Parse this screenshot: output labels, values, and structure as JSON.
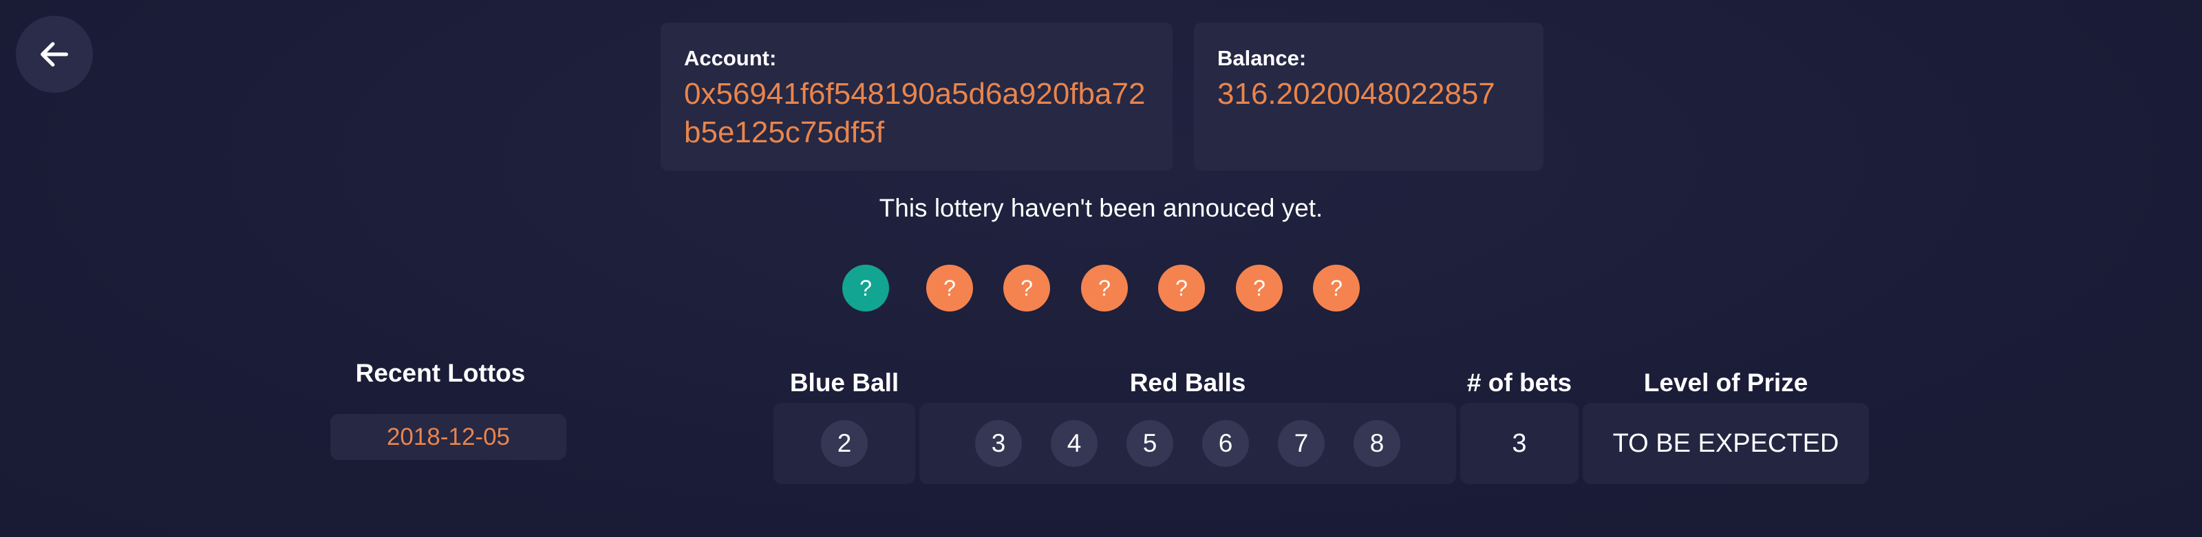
{
  "icons": {
    "back": "arrow-left-icon"
  },
  "account": {
    "label": "Account:",
    "value": "0x56941f6f548190a5d6a920fba72b5e125c75df5f"
  },
  "balance": {
    "label": "Balance:",
    "value": "316.2020048022857"
  },
  "status_message": "This lottery haven't been annouced yet.",
  "unknown_balls": {
    "blue": "?",
    "red": [
      "?",
      "?",
      "?",
      "?",
      "?",
      "?"
    ]
  },
  "recent": {
    "title": "Recent Lottos",
    "items": [
      "2018-12-05"
    ]
  },
  "table": {
    "headers": {
      "blue": "Blue Ball",
      "red": "Red Balls",
      "bets": "# of bets",
      "prize": "Level of Prize"
    },
    "row": {
      "blue": "2",
      "red": [
        "3",
        "4",
        "5",
        "6",
        "7",
        "8"
      ],
      "bets": "3",
      "prize": "TO BE EXPECTED"
    }
  },
  "colors": {
    "accent_orange": "#e9854c",
    "blue_ball": "#12a592",
    "red_ball": "#f5834f",
    "background": "#1b1d38",
    "card": "#262844"
  }
}
